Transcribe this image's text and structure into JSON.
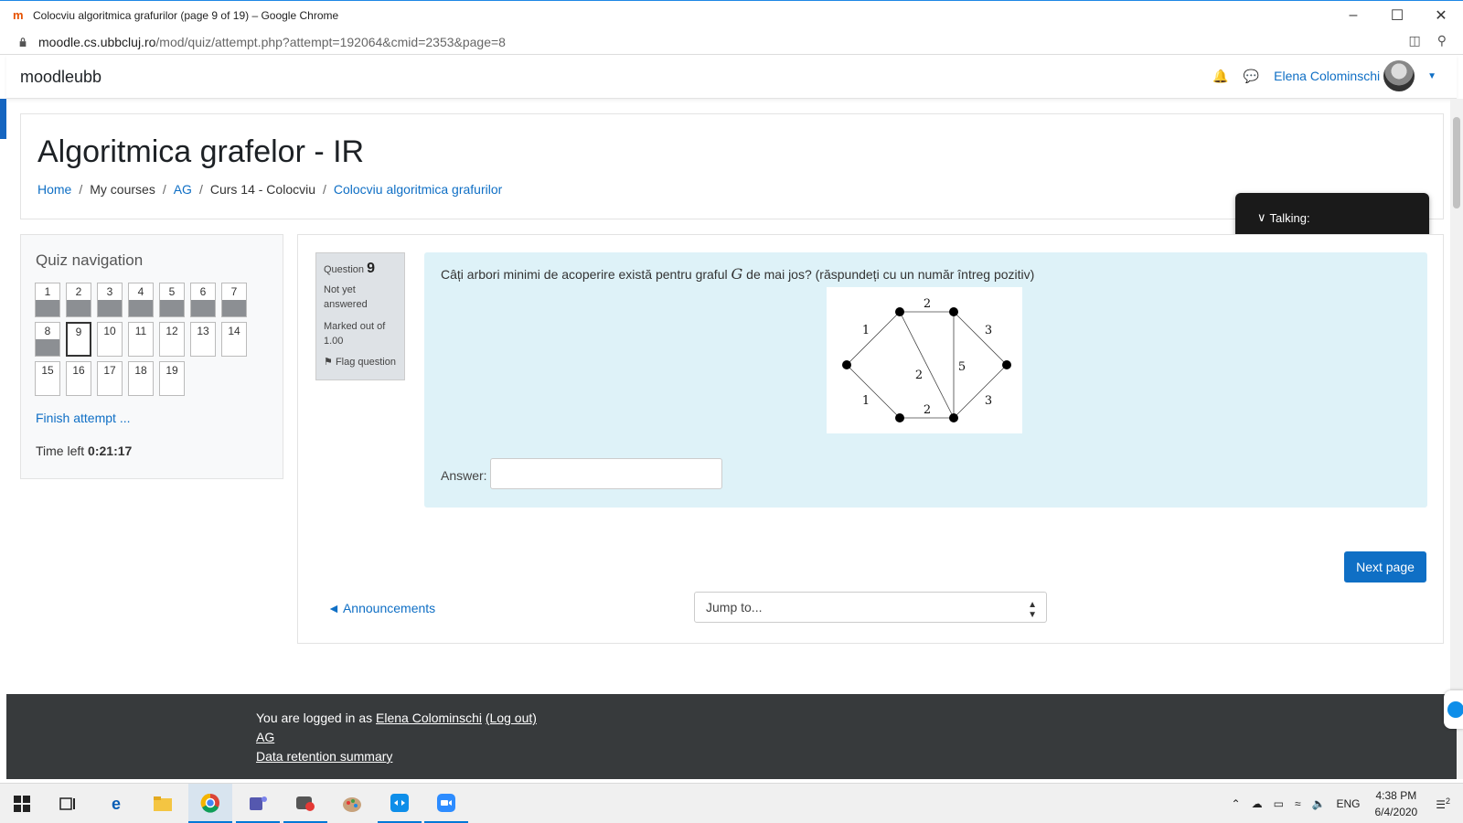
{
  "browser": {
    "tab_title": "Colocviu algoritmica grafurilor (page 9 of 19) – Google Chrome",
    "url_domain": "moodle.cs.ubbcluj.ro",
    "url_path": "/mod/quiz/attempt.php?attempt=192064&cmid=2353&page=8"
  },
  "navbar": {
    "brand": "moodleubb",
    "user_name": "Elena Colominschi"
  },
  "header": {
    "page_title": "Algoritmica grafelor - IR",
    "breadcrumb": [
      "Home",
      "My courses",
      "AG",
      "Curs 14 - Colocviu",
      "Colocviu algoritmica grafurilor"
    ]
  },
  "talking_overlay": {
    "label": "Talking:"
  },
  "quiz_nav": {
    "title": "Quiz navigation",
    "buttons": [
      "1",
      "2",
      "3",
      "4",
      "5",
      "6",
      "7",
      "8",
      "9",
      "10",
      "11",
      "12",
      "13",
      "14",
      "15",
      "16",
      "17",
      "18",
      "19"
    ],
    "answered": [
      1,
      2,
      3,
      4,
      5,
      6,
      7,
      8
    ],
    "current": 9,
    "finish_link": "Finish attempt ...",
    "time_left_label": "Time left",
    "time_left_value": "0:21:17"
  },
  "question": {
    "label": "Question",
    "number": "9",
    "state": "Not yet answered",
    "mark": "Marked out of 1.00",
    "flag": "Flag question",
    "text_before": "Câți arbori minimi de acoperire există pentru graful ",
    "text_var": "G",
    "text_after": " de mai jos? (răspundeți cu un număr întreg pozitiv)",
    "edge_weights": [
      "2",
      "1",
      "3",
      "2",
      "5",
      "1",
      "2",
      "3"
    ],
    "answer_label": "Answer:",
    "answer_value": ""
  },
  "actions": {
    "next_page": "Next page",
    "announcements": "◄ Announcements",
    "jump_to": "Jump to..."
  },
  "footer": {
    "logged_in_prefix": "You are logged in as ",
    "user": "Elena Colominschi",
    "logout": "(Log out)",
    "course": "AG",
    "data_retention": "Data retention summary"
  },
  "taskbar": {
    "language": "ENG",
    "time": "4:38 PM",
    "date": "6/4/2020",
    "notification_count": "2"
  }
}
